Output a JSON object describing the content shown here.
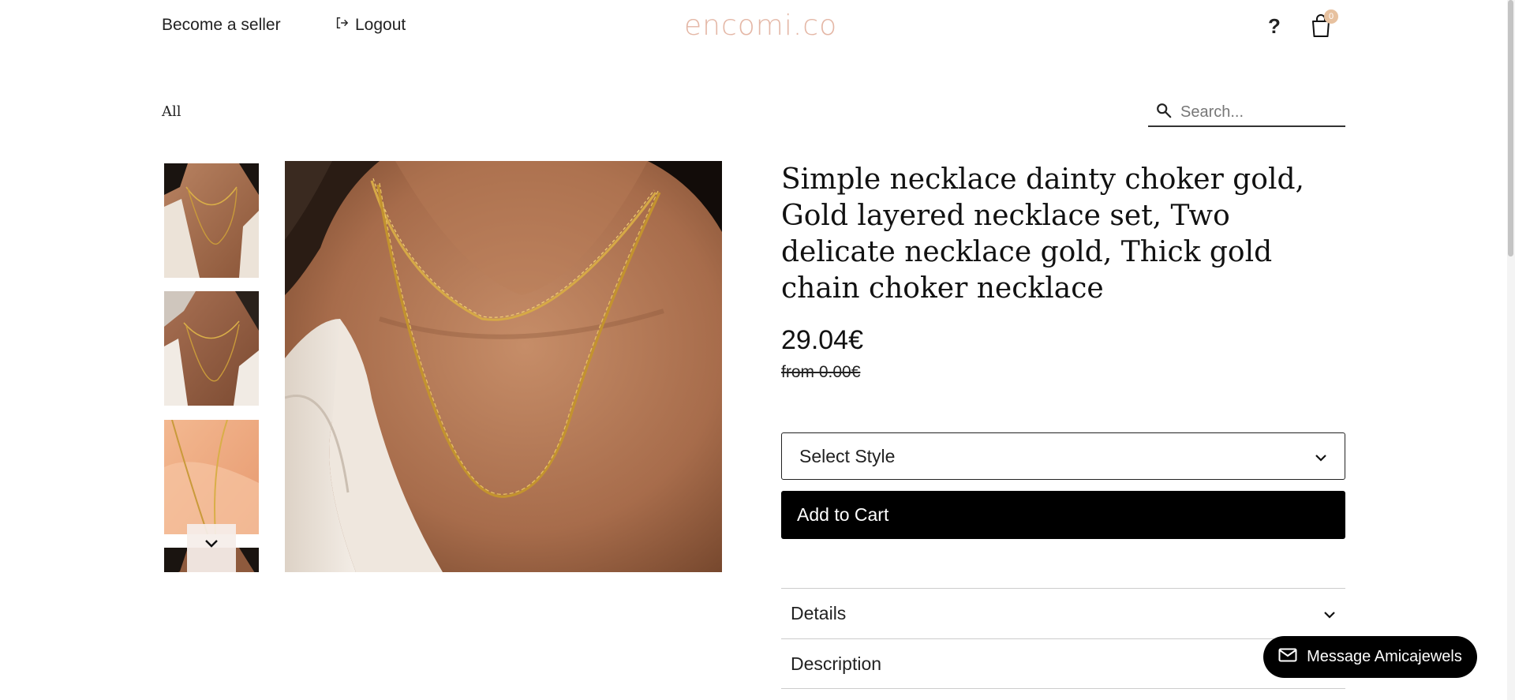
{
  "header": {
    "become_seller": "Become a seller",
    "logout": "Logout",
    "logo": "encomi.co",
    "help": "?",
    "cart_count": "0"
  },
  "categories": {
    "all": "All"
  },
  "search": {
    "placeholder": "Search..."
  },
  "product": {
    "title": "Simple necklace dainty choker gold, Gold layered necklace set, Two delicate necklace gold, Thick gold chain choker necklace",
    "price": "29.04€",
    "old_price": "from 0.00€",
    "select_label": "Select Style",
    "add_to_cart": "Add to Cart"
  },
  "accordion": {
    "details": "Details",
    "description": "Description"
  },
  "message": {
    "label": "Message Amicajewels"
  },
  "icons": {
    "logout": "logout-icon",
    "cart": "shopping-bag-icon",
    "search": "search-icon",
    "chevron": "chevron-down-icon",
    "mail": "mail-icon"
  },
  "colors": {
    "logo": "#e4b7a6",
    "cart_badge": "#e7c19f",
    "button": "#000000"
  }
}
